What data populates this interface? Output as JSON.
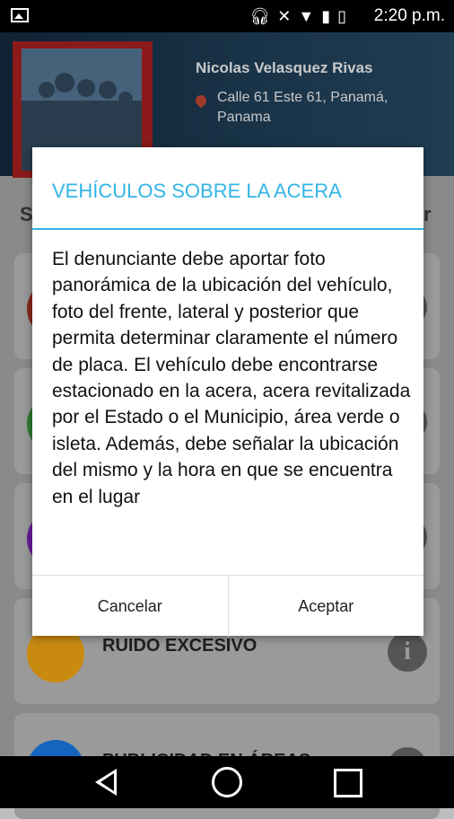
{
  "status_bar": {
    "time": "2:20 p.m."
  },
  "profile": {
    "name": "Nicolas Velasquez Rivas",
    "address": "Calle 61 Este 61, Panamá, Panama"
  },
  "background": {
    "section_start": "S",
    "section_end": "r",
    "cards": [
      {
        "title": "",
        "color": "#8a2a20"
      },
      {
        "title": "",
        "color": "#2e7d32"
      },
      {
        "title": "",
        "color": "#6a1b9a"
      },
      {
        "title": "RUIDO EXCESIVO",
        "color": "#c98a10"
      },
      {
        "title": "PUBLICIDAD EN ÁREAS",
        "color": "#1565c0"
      }
    ]
  },
  "dialog": {
    "title": "VEHÍCULOS SOBRE LA ACERA",
    "body": "El denunciante debe aportar foto panorámica de la ubicación del vehículo, foto del frente, lateral y posterior que permita determinar claramente el número de placa. El vehículo debe encontrarse estacionado en la acera, acera revitalizada por el Estado o el Municipio, área verde o isleta. Además, debe señalar la ubicación del mismo y la hora en que se encuentra en el lugar",
    "cancel_label": "Cancelar",
    "accept_label": "Aceptar",
    "accent_color": "#33b5e5"
  }
}
